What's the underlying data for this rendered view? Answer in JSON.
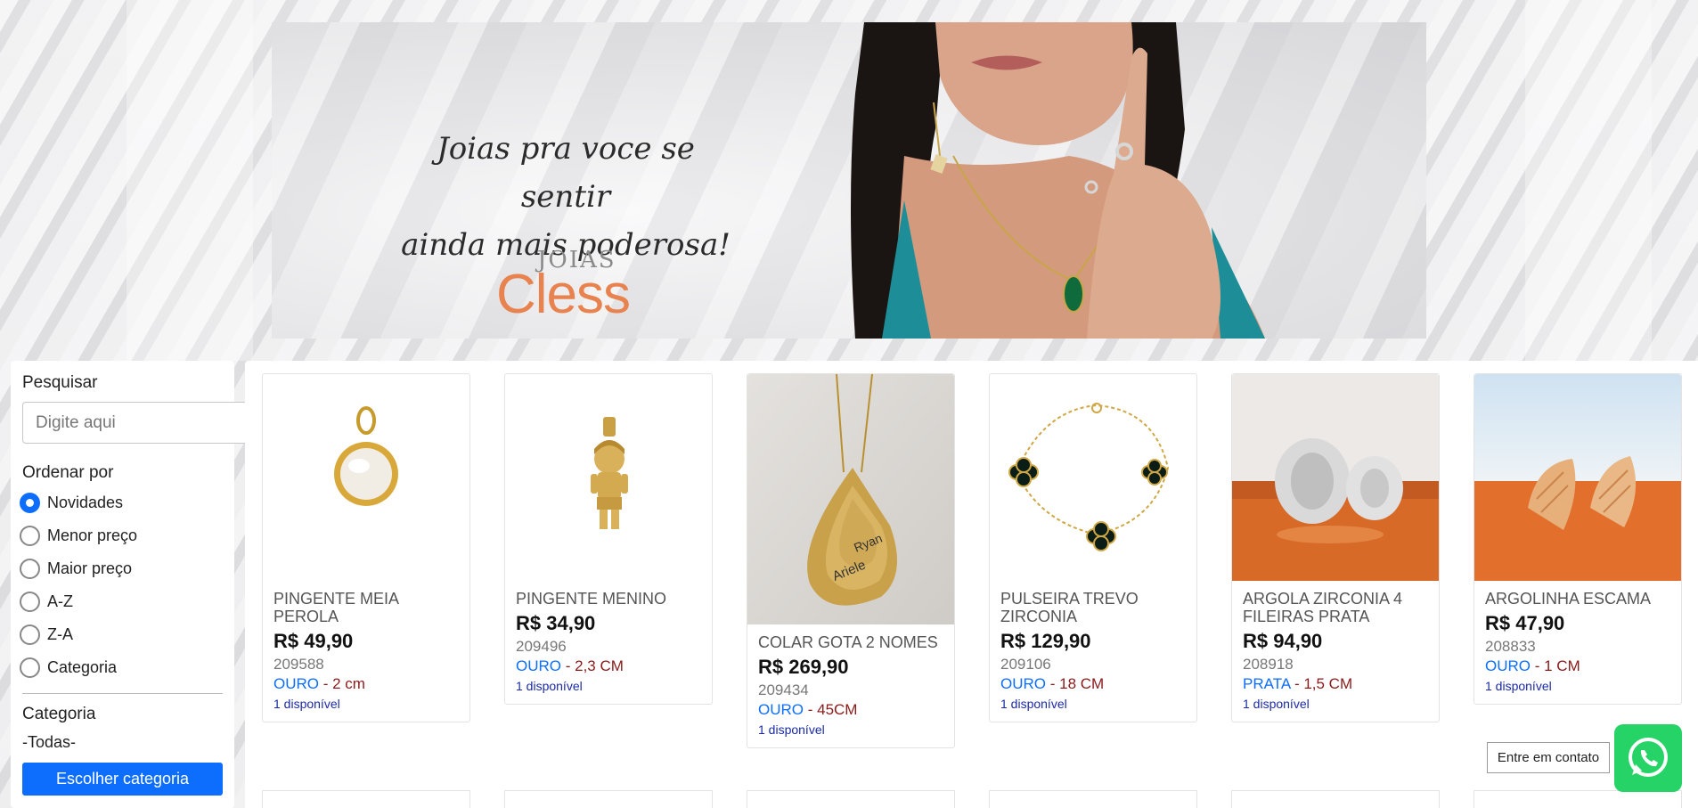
{
  "banner": {
    "tagline_line1": "Joias pra voce se sentir",
    "tagline_line2": "ainda mais poderosa!",
    "logo_small": "JOIAS",
    "logo_big": "Cless"
  },
  "sidebar": {
    "search_label": "Pesquisar",
    "search_placeholder": "Digite aqui",
    "sort_label": "Ordenar por",
    "sort_options": [
      "Novidades",
      "Menor preço",
      "Maior preço",
      "A-Z",
      "Z-A",
      "Categoria"
    ],
    "sort_selected": "Novidades",
    "category_label": "Categoria",
    "category_current": "-Todas-",
    "category_button": "Escolher categoria"
  },
  "products": [
    {
      "name": "PINGENTE MEIA PEROLA",
      "price": "R$ 49,90",
      "code": "209588",
      "metal": "OURO",
      "size": "2 cm",
      "stock": "1 disponível",
      "image": "pearl-pendant"
    },
    {
      "name": "PINGENTE MENINO",
      "price": "R$ 34,90",
      "code": "209496",
      "metal": "OURO",
      "size": "2,3 CM",
      "stock": "1 disponível",
      "image": "boy-pendant"
    },
    {
      "name": "COLAR GOTA 2 NOMES",
      "price": "R$ 269,90",
      "code": "209434",
      "metal": "OURO",
      "size": "45CM",
      "stock": "1 disponível",
      "image": "drop-necklace",
      "image_names": [
        "Ryan",
        "Ariele"
      ]
    },
    {
      "name": "PULSEIRA TREVO ZIRCONIA",
      "price": "R$ 129,90",
      "code": "209106",
      "metal": "OURO",
      "size": "18 CM",
      "stock": "1 disponível",
      "image": "clover-bracelet"
    },
    {
      "name": "ARGOLA ZIRCONIA 4 FILEIRAS PRATA",
      "price": "R$ 94,90",
      "code": "208918",
      "metal": "PRATA",
      "size": "1,5 CM",
      "stock": "1 disponível",
      "image": "zirconia-hoops"
    },
    {
      "name": "ARGOLINHA ESCAMA",
      "price": "R$ 47,90",
      "code": "208833",
      "metal": "OURO",
      "size": "1 CM",
      "stock": "1 disponível",
      "image": "scale-hoops"
    }
  ],
  "spec_separator": " - ",
  "contact_button": "Entre em contato",
  "whatsapp_icon": "whatsapp-icon",
  "colors": {
    "accent": "#0d6efd",
    "metal": "#0d6efd",
    "size": "#8b1a1a",
    "stock": "#1a2aa8",
    "whatsapp": "#25d366",
    "logo": "#e8834f"
  }
}
